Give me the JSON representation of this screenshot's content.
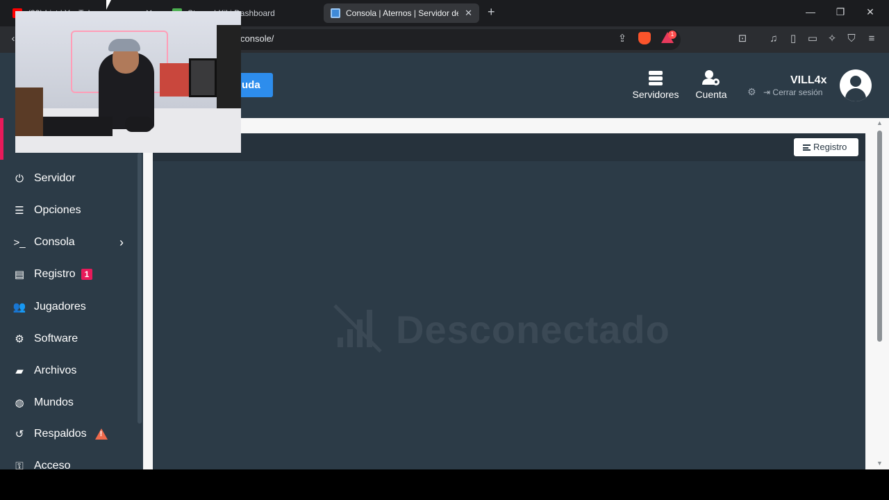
{
  "tabs": [
    {
      "label": "(32) List | YouTube",
      "active": false
    },
    {
      "label": "Steam | Kiki Dashboard",
      "active": false
    },
    {
      "label": "Consola | Aternos | Servidor de M",
      "active": true
    }
  ],
  "address": {
    "url_visible": "console/"
  },
  "header": {
    "help_label": "uda",
    "nav": [
      {
        "label": "Servidores",
        "icon": "servers-icon"
      },
      {
        "label": "Cuenta",
        "icon": "account-settings-icon"
      }
    ],
    "user": {
      "name": "VILL4x",
      "logout_label": "Cerrar sesión"
    }
  },
  "sidebar": {
    "items": [
      {
        "label": "Servidor",
        "icon": "power-icon"
      },
      {
        "label": "Opciones",
        "icon": "options-icon"
      },
      {
        "label": "Consola",
        "icon": "terminal-icon"
      },
      {
        "label": "Registro",
        "icon": "file-icon",
        "badge": "1"
      },
      {
        "label": "Jugadores",
        "icon": "users-icon"
      },
      {
        "label": "Software",
        "icon": "gears-icon"
      },
      {
        "label": "Archivos",
        "icon": "folder-icon"
      },
      {
        "label": "Mundos",
        "icon": "globe-icon"
      },
      {
        "label": "Respaldos",
        "icon": "history-icon"
      },
      {
        "label": "Acceso",
        "icon": "key-icon"
      }
    ]
  },
  "console": {
    "log_button": "Registro",
    "status": "Desconectado"
  },
  "colors": {
    "header_bg": "#2c3b47",
    "accent_red": "#e81a5a",
    "help_blue": "#2d8ded"
  }
}
